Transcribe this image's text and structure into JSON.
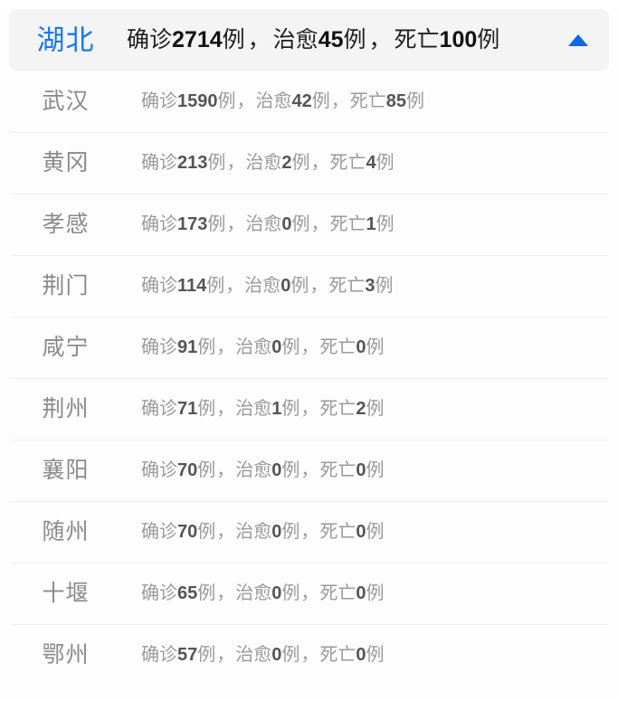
{
  "header": {
    "province": "湖北",
    "stats": {
      "confirmed_label": "确诊",
      "confirmed_value": "2714",
      "cured_label": "治愈",
      "cured_value": "45",
      "deaths_label": "死亡",
      "deaths_value": "100",
      "unit": "例",
      "separator": "，"
    },
    "collapse_icon": "triangle-up-icon",
    "accent_color": "#1877f2",
    "background_color": "#f4f4f5"
  },
  "labels": {
    "confirmed": "确诊",
    "cured": "治愈",
    "deaths": "死亡",
    "unit": "例",
    "separator": "，"
  },
  "cities": [
    {
      "name": "武汉",
      "confirmed": "1590",
      "cured": "42",
      "deaths": "85"
    },
    {
      "name": "黄冈",
      "confirmed": "213",
      "cured": "2",
      "deaths": "4"
    },
    {
      "name": "孝感",
      "confirmed": "173",
      "cured": "0",
      "deaths": "1"
    },
    {
      "name": "荆门",
      "confirmed": "114",
      "cured": "0",
      "deaths": "3"
    },
    {
      "name": "咸宁",
      "confirmed": "91",
      "cured": "0",
      "deaths": "0"
    },
    {
      "name": "荆州",
      "confirmed": "71",
      "cured": "1",
      "deaths": "2"
    },
    {
      "name": "襄阳",
      "confirmed": "70",
      "cured": "0",
      "deaths": "0"
    },
    {
      "name": "随州",
      "confirmed": "70",
      "cured": "0",
      "deaths": "0"
    },
    {
      "name": "十堰",
      "confirmed": "65",
      "cured": "0",
      "deaths": "0"
    },
    {
      "name": "鄂州",
      "confirmed": "57",
      "cured": "0",
      "deaths": "0"
    }
  ]
}
